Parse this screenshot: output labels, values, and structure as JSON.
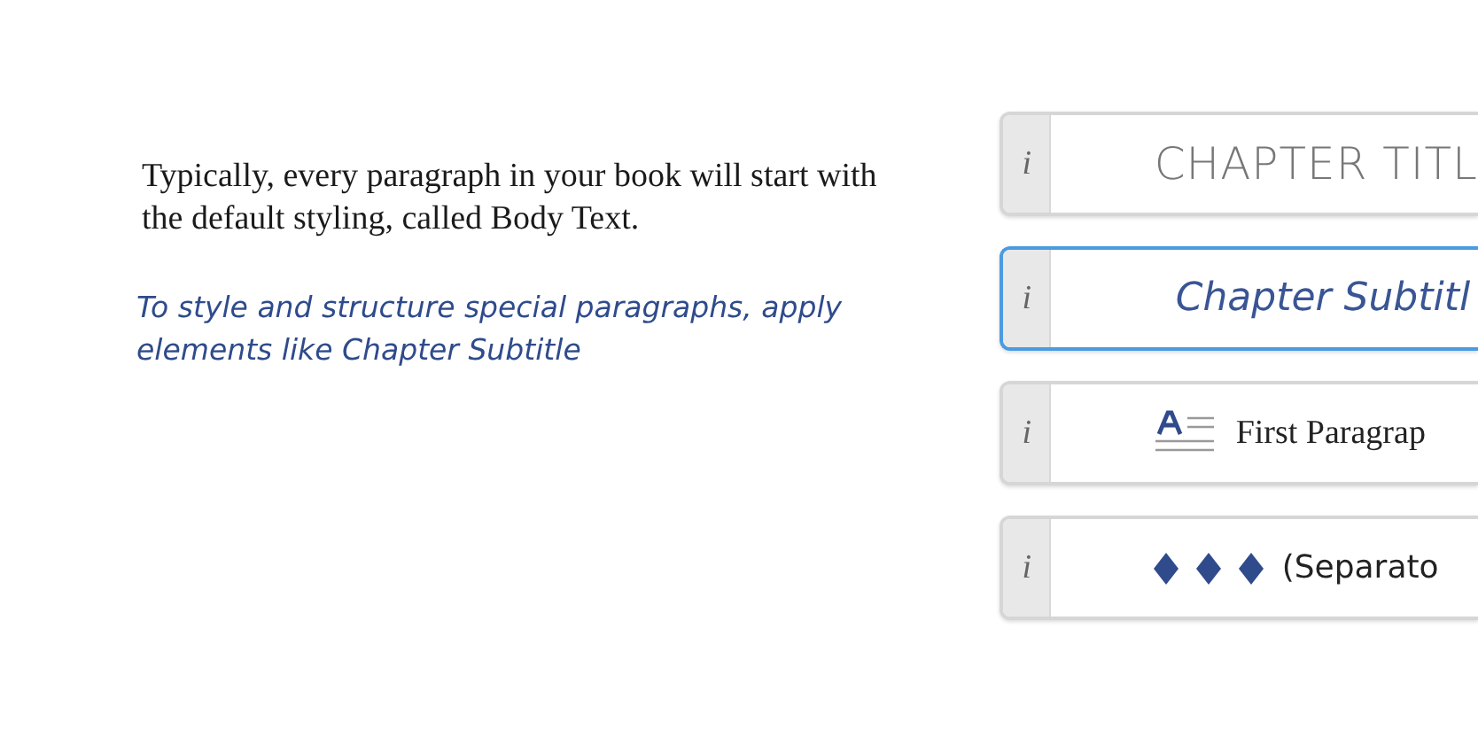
{
  "intro": {
    "body_text": "Typically, every paragraph in your book will start with the default styling, called Body Text.",
    "note": "To style and structure special paragraphs, apply elements like Chapter Subtitle"
  },
  "elements": [
    {
      "kind": "title",
      "info": "i",
      "label": "CHAPTER TITL",
      "selected": false
    },
    {
      "kind": "subtitle",
      "info": "i",
      "label": "Chapter Subtitl",
      "selected": true
    },
    {
      "kind": "first-paragraph",
      "info": "i",
      "label": "First Paragrap",
      "selected": false
    },
    {
      "kind": "separator",
      "info": "i",
      "label": "(Separato",
      "selected": false
    }
  ]
}
